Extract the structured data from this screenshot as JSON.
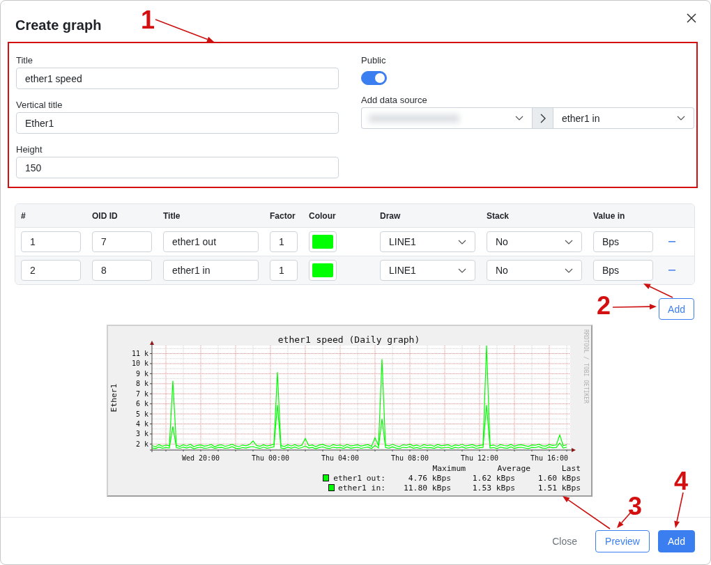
{
  "dialog": {
    "title": "Create graph"
  },
  "form": {
    "fields": [
      {
        "label": "Title",
        "value": "ether1 speed"
      },
      {
        "label": "Vertical title",
        "value": "Ether1"
      },
      {
        "label": "Height",
        "value": "150"
      }
    ],
    "public": {
      "label": "Public",
      "on": true
    },
    "data_source": {
      "label": "Add data source",
      "device": {
        "redacted": true
      },
      "item": {
        "value": "ether1 in"
      }
    }
  },
  "table": {
    "columns": [
      "#",
      "OID ID",
      "Title",
      "Factor",
      "Colour",
      "Draw",
      "Stack",
      "Value in"
    ],
    "rows": [
      {
        "index": "1",
        "oid_id": "7",
        "title": "ether1 out",
        "factor": "1",
        "color": "#00ff00",
        "draw": "LINE1",
        "stack": "No",
        "value_in": "Bps"
      },
      {
        "index": "2",
        "oid_id": "8",
        "title": "ether1 in",
        "factor": "1",
        "color": "#00ff00",
        "draw": "LINE1",
        "stack": "No",
        "value_in": "Bps"
      }
    ]
  },
  "add_row_button": {
    "label": "Add"
  },
  "graph_preview": {
    "credit": "RRDTOOL / TOBI OETIKER",
    "chart_data": {
      "type": "line",
      "title": "ether1 speed (Daily graph)",
      "ylabel": "Ether1",
      "grid": true,
      "legend": "bottom",
      "categories": [
        null,
        null,
        null,
        null,
        null,
        null,
        null,
        null,
        null,
        null,
        null,
        null,
        null,
        null,
        "Wed 20:00",
        null,
        null,
        null,
        null,
        null,
        null,
        null,
        null,
        null,
        null,
        null,
        null,
        null,
        null,
        null,
        null,
        null,
        null,
        null,
        "Thu 00:00",
        null,
        null,
        null,
        null,
        null,
        null,
        null,
        null,
        null,
        null,
        null,
        null,
        null,
        null,
        null,
        null,
        null,
        null,
        null,
        "Thu 04:00",
        null,
        null,
        null,
        null,
        null,
        null,
        null,
        null,
        null,
        null,
        null,
        null,
        null,
        null,
        null,
        null,
        null,
        null,
        null,
        "Thu 08:00",
        null,
        null,
        null,
        null,
        null,
        null,
        null,
        null,
        null,
        null,
        null,
        null,
        null,
        null,
        null,
        null,
        null,
        null,
        null,
        "Thu 12:00",
        null,
        null,
        null,
        null,
        null,
        null,
        null,
        null,
        null,
        null,
        null,
        null,
        null,
        null,
        null,
        null,
        null,
        null,
        null,
        "Thu 16:00",
        null,
        null,
        null,
        null,
        null
      ],
      "series": [
        {
          "name": "ether1 out:",
          "color": "#00ff00",
          "values": [
            1.62,
            1.55,
            1.7,
            1.58,
            1.66,
            1.6,
            3.75,
            1.64,
            1.57,
            1.69,
            1.6,
            1.72,
            1.54,
            1.63,
            1.68,
            1.58,
            1.61,
            1.71,
            1.56,
            1.65,
            1.67,
            1.57,
            1.62,
            1.73,
            1.59,
            1.55,
            1.66,
            1.6,
            1.7,
            1.75,
            1.63,
            1.56,
            1.69,
            1.59,
            1.64,
            1.72,
            5.88,
            1.61,
            1.55,
            1.68,
            1.58,
            1.7,
            1.57,
            1.64,
            1.8,
            1.6,
            1.67,
            1.54,
            1.65,
            1.71,
            1.6,
            1.56,
            1.69,
            1.62,
            1.66,
            1.57,
            1.72,
            1.59,
            1.63,
            1.68,
            1.57,
            1.64,
            1.7,
            1.55,
            1.85,
            1.61,
            4.5,
            1.66,
            1.58,
            1.72,
            1.6,
            1.54,
            1.68,
            1.63,
            1.73,
            1.59,
            1.65,
            1.56,
            1.69,
            1.62,
            1.66,
            1.57,
            1.71,
            1.6,
            1.64,
            1.68,
            1.55,
            1.67,
            1.61,
            1.72,
            1.58,
            1.64,
            1.7,
            1.57,
            1.63,
            1.67,
            5.88,
            1.6,
            1.66,
            1.55,
            1.69,
            1.62,
            1.59,
            1.71,
            1.56,
            1.65,
            1.68,
            1.61,
            1.54,
            1.67,
            1.64,
            1.73,
            1.6,
            1.57,
            1.7,
            1.63,
            1.66,
            2.1,
            1.6,
            1.68
          ]
        },
        {
          "name": "ether1 in:",
          "color": "#00ff00",
          "values": [
            1.85,
            1.72,
            1.95,
            1.78,
            1.9,
            1.82,
            8.3,
            1.88,
            1.76,
            1.93,
            1.8,
            1.97,
            1.74,
            1.86,
            1.91,
            1.79,
            1.84,
            1.96,
            1.73,
            1.88,
            1.92,
            1.77,
            1.85,
            1.98,
            1.8,
            1.75,
            1.9,
            1.83,
            1.95,
            2.3,
            1.86,
            1.78,
            1.93,
            1.81,
            1.88,
            1.97,
            9.15,
            1.84,
            1.76,
            1.92,
            1.8,
            1.95,
            1.79,
            1.87,
            2.55,
            1.83,
            1.91,
            1.74,
            1.89,
            1.96,
            1.82,
            1.77,
            1.94,
            1.85,
            1.9,
            1.78,
            1.97,
            1.81,
            1.86,
            1.93,
            1.79,
            1.88,
            1.95,
            1.76,
            2.62,
            1.84,
            10.45,
            1.9,
            1.8,
            1.97,
            1.83,
            1.75,
            1.92,
            1.87,
            1.98,
            1.81,
            1.89,
            1.77,
            1.94,
            1.85,
            1.9,
            1.78,
            1.96,
            1.82,
            1.87,
            1.93,
            1.76,
            1.91,
            1.84,
            1.97,
            1.8,
            1.88,
            1.95,
            1.79,
            1.86,
            1.92,
            11.8,
            1.83,
            1.9,
            1.77,
            1.94,
            1.85,
            1.81,
            1.96,
            1.78,
            1.89,
            1.93,
            1.84,
            1.76,
            1.91,
            1.87,
            1.98,
            1.82,
            1.79,
            1.95,
            1.86,
            1.9,
            2.9,
            1.83,
            1.92
          ]
        }
      ],
      "ylim": [
        1.4,
        11.8
      ],
      "yticks": [
        {
          "value": 2,
          "label": "2 k"
        },
        {
          "value": 3,
          "label": "3 k"
        },
        {
          "value": 4,
          "label": "4 k"
        },
        {
          "value": 5,
          "label": "5 k"
        },
        {
          "value": 6,
          "label": "6 k"
        },
        {
          "value": 7,
          "label": "7 k"
        },
        {
          "value": 8,
          "label": "8 k"
        },
        {
          "value": 9,
          "label": "9 k"
        },
        {
          "value": 10,
          "label": "10 k"
        },
        {
          "value": 11,
          "label": "11 k"
        }
      ]
    },
    "legend": {
      "headers": [
        "Maximum",
        "Average",
        "Last"
      ],
      "rows": [
        {
          "values": [
            "4.76 kBps",
            "1.62 kBps",
            "1.60 kBps"
          ]
        },
        {
          "values": [
            "11.80 kBps",
            "1.53 kBps",
            "1.51 kBps"
          ]
        }
      ]
    }
  },
  "footer": {
    "buttons": [
      {
        "label": "Close",
        "kind": "link"
      },
      {
        "label": "Preview",
        "kind": "outline"
      },
      {
        "label": "Add",
        "kind": "primary"
      }
    ]
  },
  "annotations": [
    {
      "label": "1"
    },
    {
      "label": "2"
    },
    {
      "label": "3"
    },
    {
      "label": "4"
    }
  ]
}
